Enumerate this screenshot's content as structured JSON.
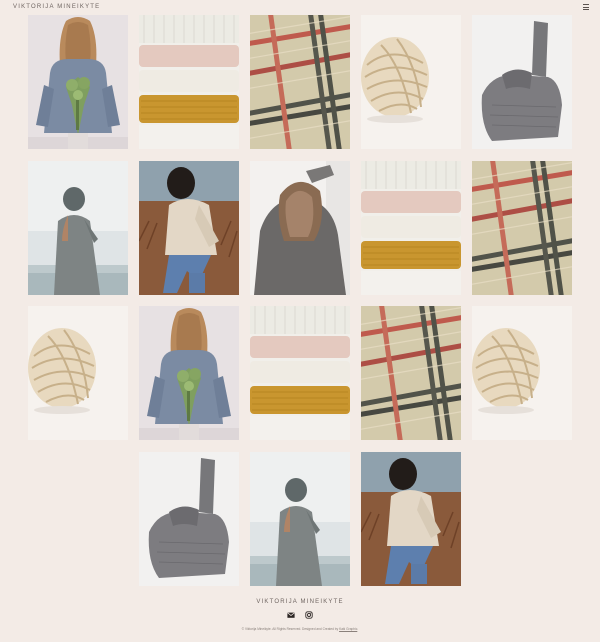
{
  "header": {
    "site_title": "VIKTORIJA MINEIKYTE",
    "menu_icon": "hamburger-menu-icon"
  },
  "gallery": {
    "tiles": [
      {
        "subject": "woman-sweater-bouquet"
      },
      {
        "subject": "folded-knits"
      },
      {
        "subject": "plaid-knit-closeup"
      },
      {
        "subject": "yarn-ball"
      },
      {
        "subject": "grey-sweater-flatlay"
      },
      {
        "subject": "woman-beanie-cardigan"
      },
      {
        "subject": "woman-sitting-field"
      },
      {
        "subject": "woman-hair-sweater"
      },
      {
        "subject": "folded-knits"
      },
      {
        "subject": "plaid-knit-closeup"
      },
      {
        "subject": "yarn-ball"
      },
      {
        "subject": "woman-sweater-bouquet"
      },
      {
        "subject": "folded-knits"
      },
      {
        "subject": "plaid-knit-closeup"
      },
      {
        "subject": "yarn-ball"
      },
      {
        "subject": "grey-sweater-flatlay"
      },
      {
        "subject": "woman-beanie-cardigan"
      },
      {
        "subject": "woman-sitting-field"
      }
    ]
  },
  "footer": {
    "title": "VIKTORIJA MINEIKYTE",
    "social_icons": [
      "email-icon",
      "instagram-icon"
    ],
    "copyright_text": "© Viktorija Mineikyte. All Rights Reserved. Designed and Created by ",
    "credit_link": "Kaki Graphic",
    "copyright_end": "."
  }
}
